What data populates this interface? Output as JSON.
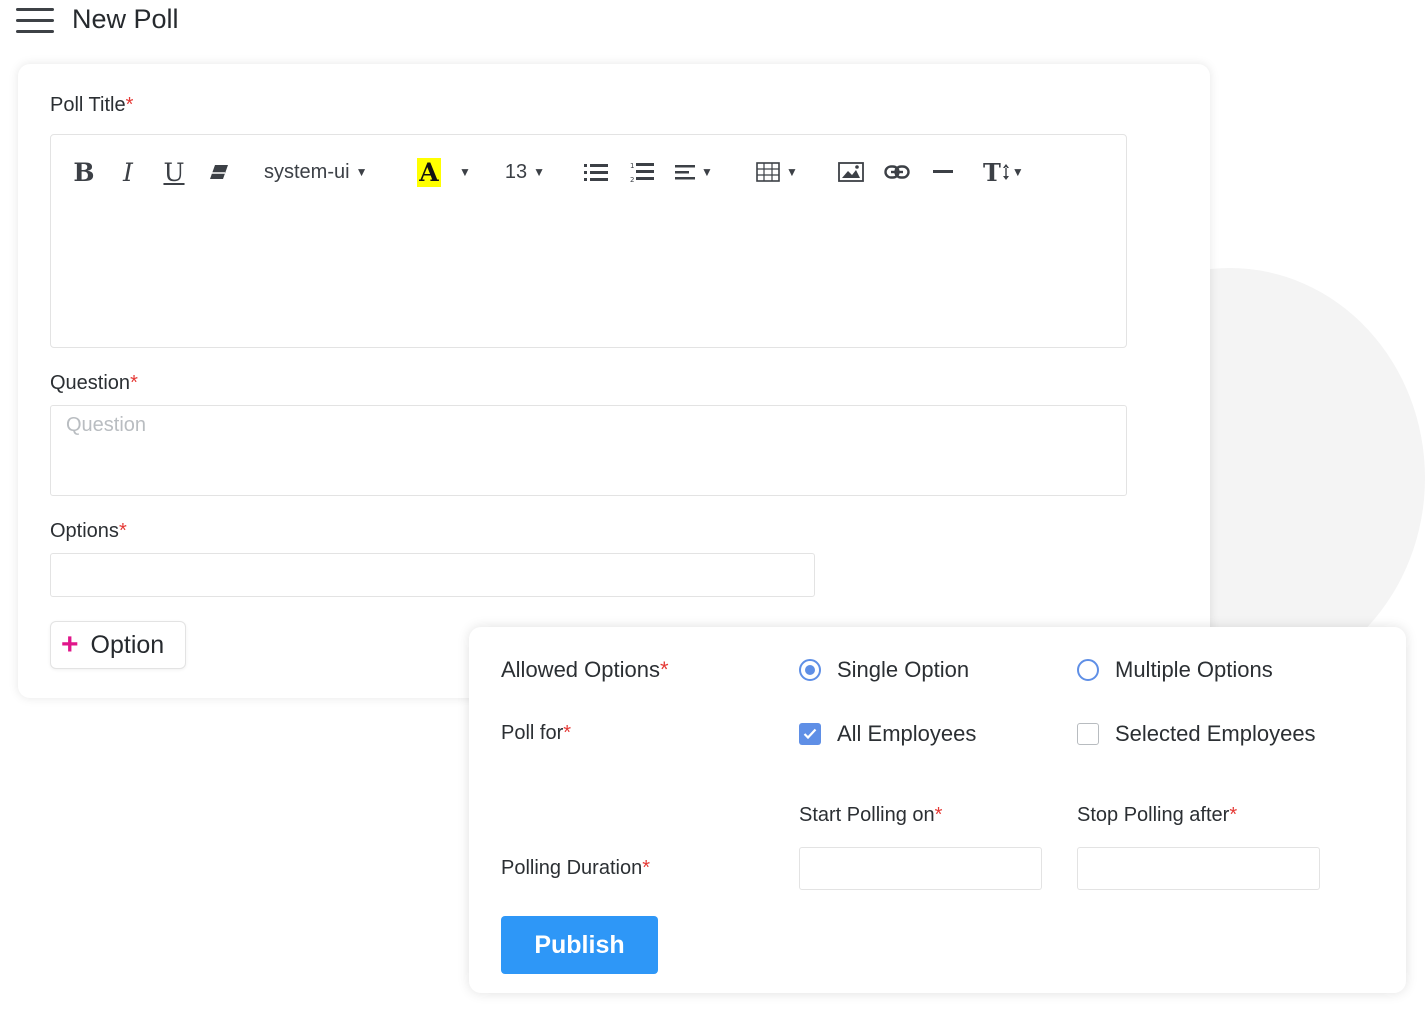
{
  "header": {
    "title": "New Poll",
    "menu_icon": "hamburger-menu-icon"
  },
  "form": {
    "poll_title_label": "Poll Title",
    "question_label": "Question",
    "question_placeholder": "Question",
    "options_label": "Options",
    "add_option_label": "Option",
    "required_mark": "*"
  },
  "toolbar": {
    "bold": "B",
    "italic": "I",
    "underline": "U",
    "font_family": "system-ui",
    "font_color_letter": "A",
    "font_size": "13",
    "text_style": "T",
    "highlight_color": "#ffff00",
    "icons": [
      "bold-icon",
      "italic-icon",
      "underline-icon",
      "eraser-icon",
      "font-color-icon",
      "bullet-list-icon",
      "numbered-list-icon",
      "align-icon",
      "table-icon",
      "image-icon",
      "link-icon",
      "horizontal-rule-icon",
      "text-style-icon"
    ]
  },
  "settings": {
    "allowed_options_label": "Allowed Options",
    "single_option_label": "Single Option",
    "multiple_options_label": "Multiple Options",
    "selected_allowed": "Single Option",
    "poll_for_label": "Poll for",
    "all_employees_label": "All Employees",
    "all_employees_checked": true,
    "selected_employees_label": "Selected Employees",
    "selected_employees_checked": false,
    "start_polling_label": "Start Polling on",
    "stop_polling_label": "Stop Polling after",
    "polling_duration_label": "Polling Duration",
    "publish_label": "Publish"
  },
  "colors": {
    "accent": "#2e97f7",
    "control_blue": "#5f8fe6",
    "required": "#e53935",
    "plus_icon": "#e0168a"
  }
}
